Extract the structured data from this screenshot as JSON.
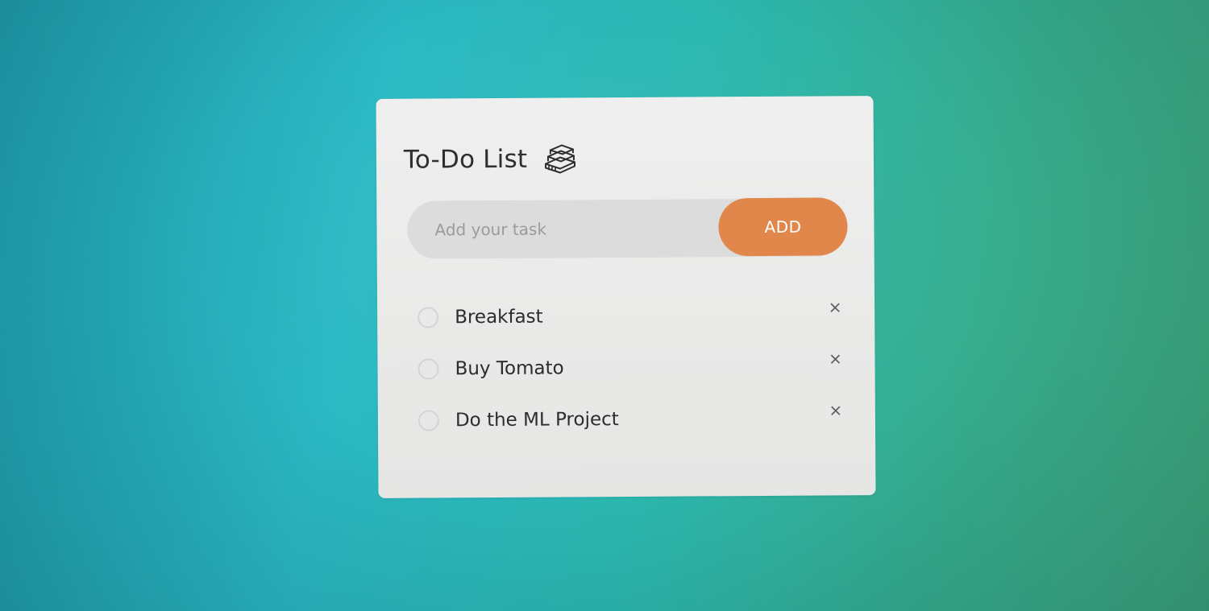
{
  "app": {
    "title": "To-Do List",
    "title_icon": "books-stack-icon"
  },
  "input": {
    "placeholder": "Add your task",
    "value": ""
  },
  "add_button": {
    "label": "ADD",
    "color": "#e2874c"
  },
  "tasks": [
    {
      "label": "Breakfast",
      "checked": false,
      "delete_symbol": "×"
    },
    {
      "label": "Buy Tomato",
      "checked": false,
      "delete_symbol": "×"
    },
    {
      "label": "Do the ML Project",
      "checked": false,
      "delete_symbol": "×"
    }
  ]
}
